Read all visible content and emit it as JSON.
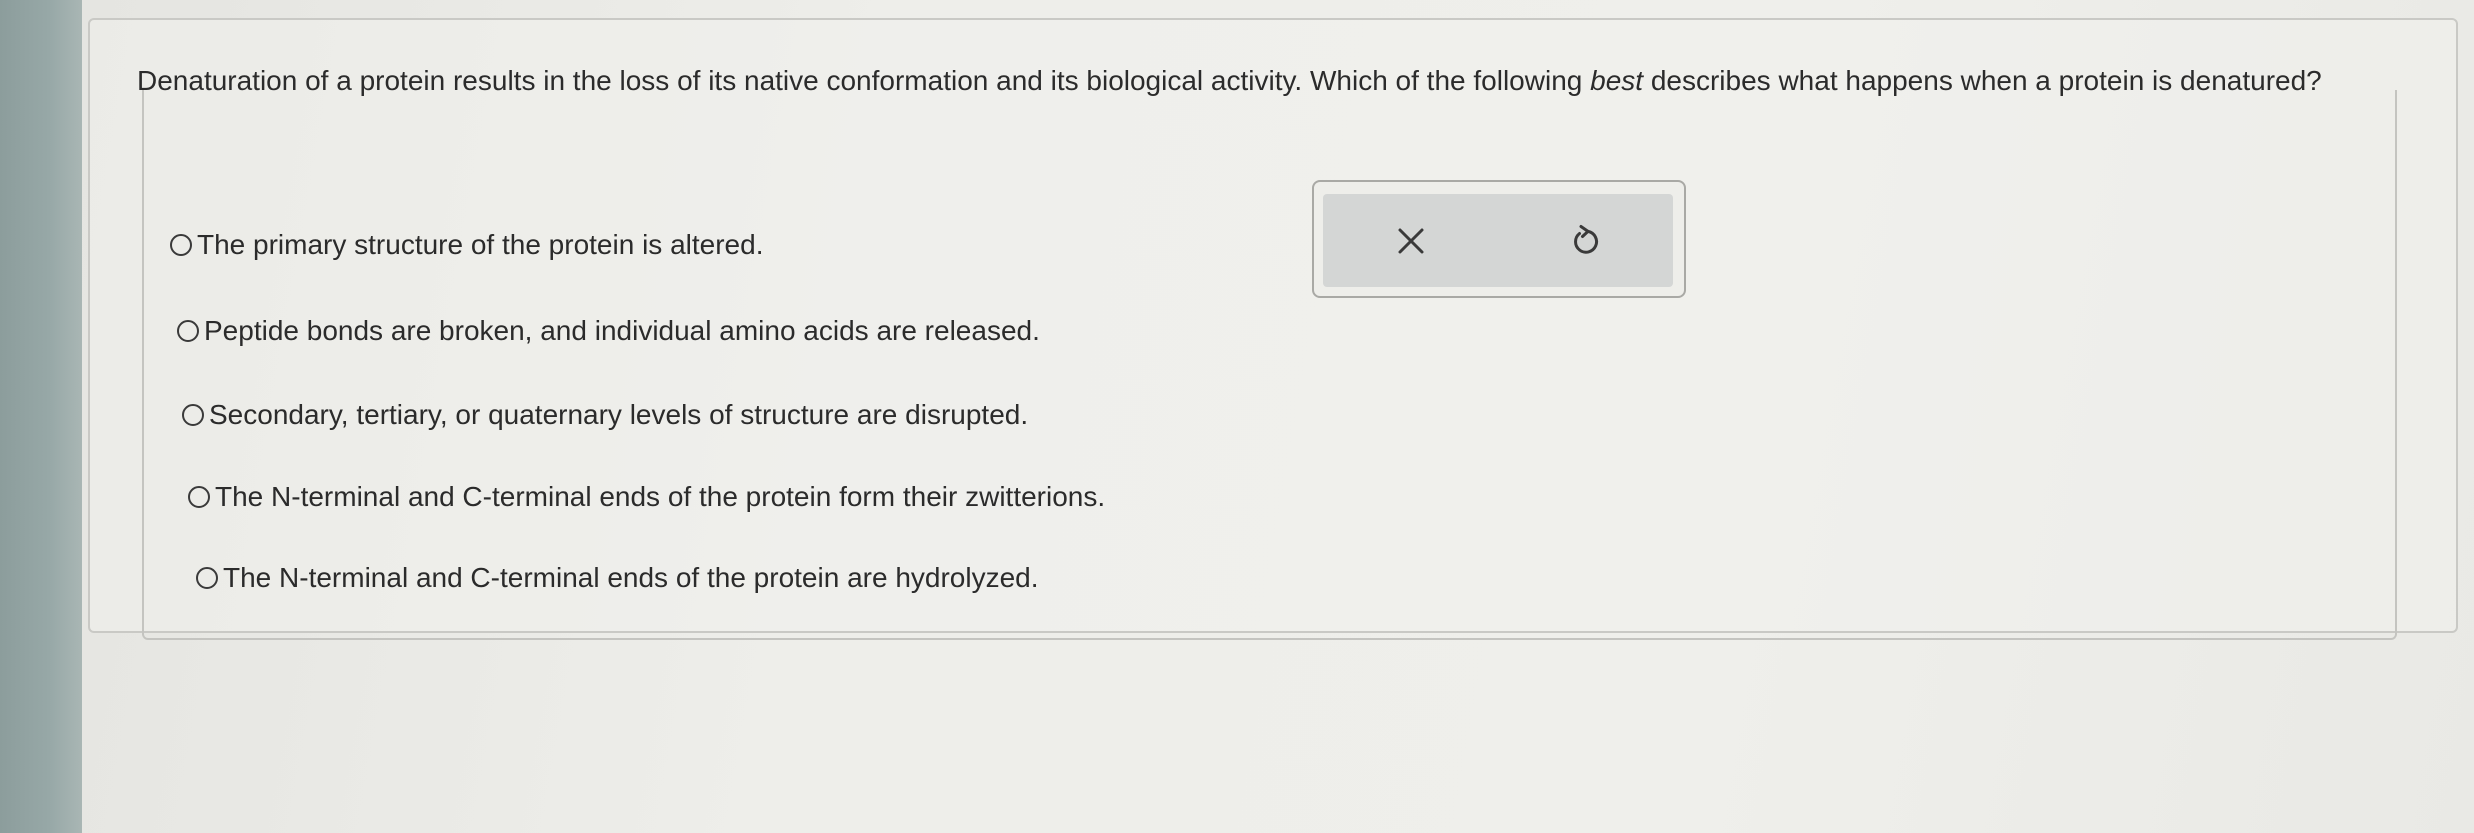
{
  "question": {
    "prefix": "Denaturation of a protein results in the loss of its native conformation and its biological activity. Which of the following ",
    "emphasis": "best",
    "suffix": " describes what happens when a protein is denatured?"
  },
  "options": [
    {
      "label": "The primary structure of the protein is altered.",
      "selected": false
    },
    {
      "label": "Peptide bonds are broken, and individual amino acids are released.",
      "selected": false
    },
    {
      "label": "Secondary, tertiary, or quaternary levels of structure are disrupted.",
      "selected": false
    },
    {
      "label": "The N-terminal and C-terminal ends of the protein form their zwitterions.",
      "selected": false
    },
    {
      "label": "The N-terminal and C-terminal ends of the protein are hydrolyzed.",
      "selected": false
    }
  ],
  "toolbar": {
    "clear_icon": "close-icon",
    "reset_icon": "undo-icon"
  },
  "colors": {
    "text": "#2b2b2b",
    "toolbar_bg": "#d4d6d5",
    "icon": "#3a3a3a"
  }
}
